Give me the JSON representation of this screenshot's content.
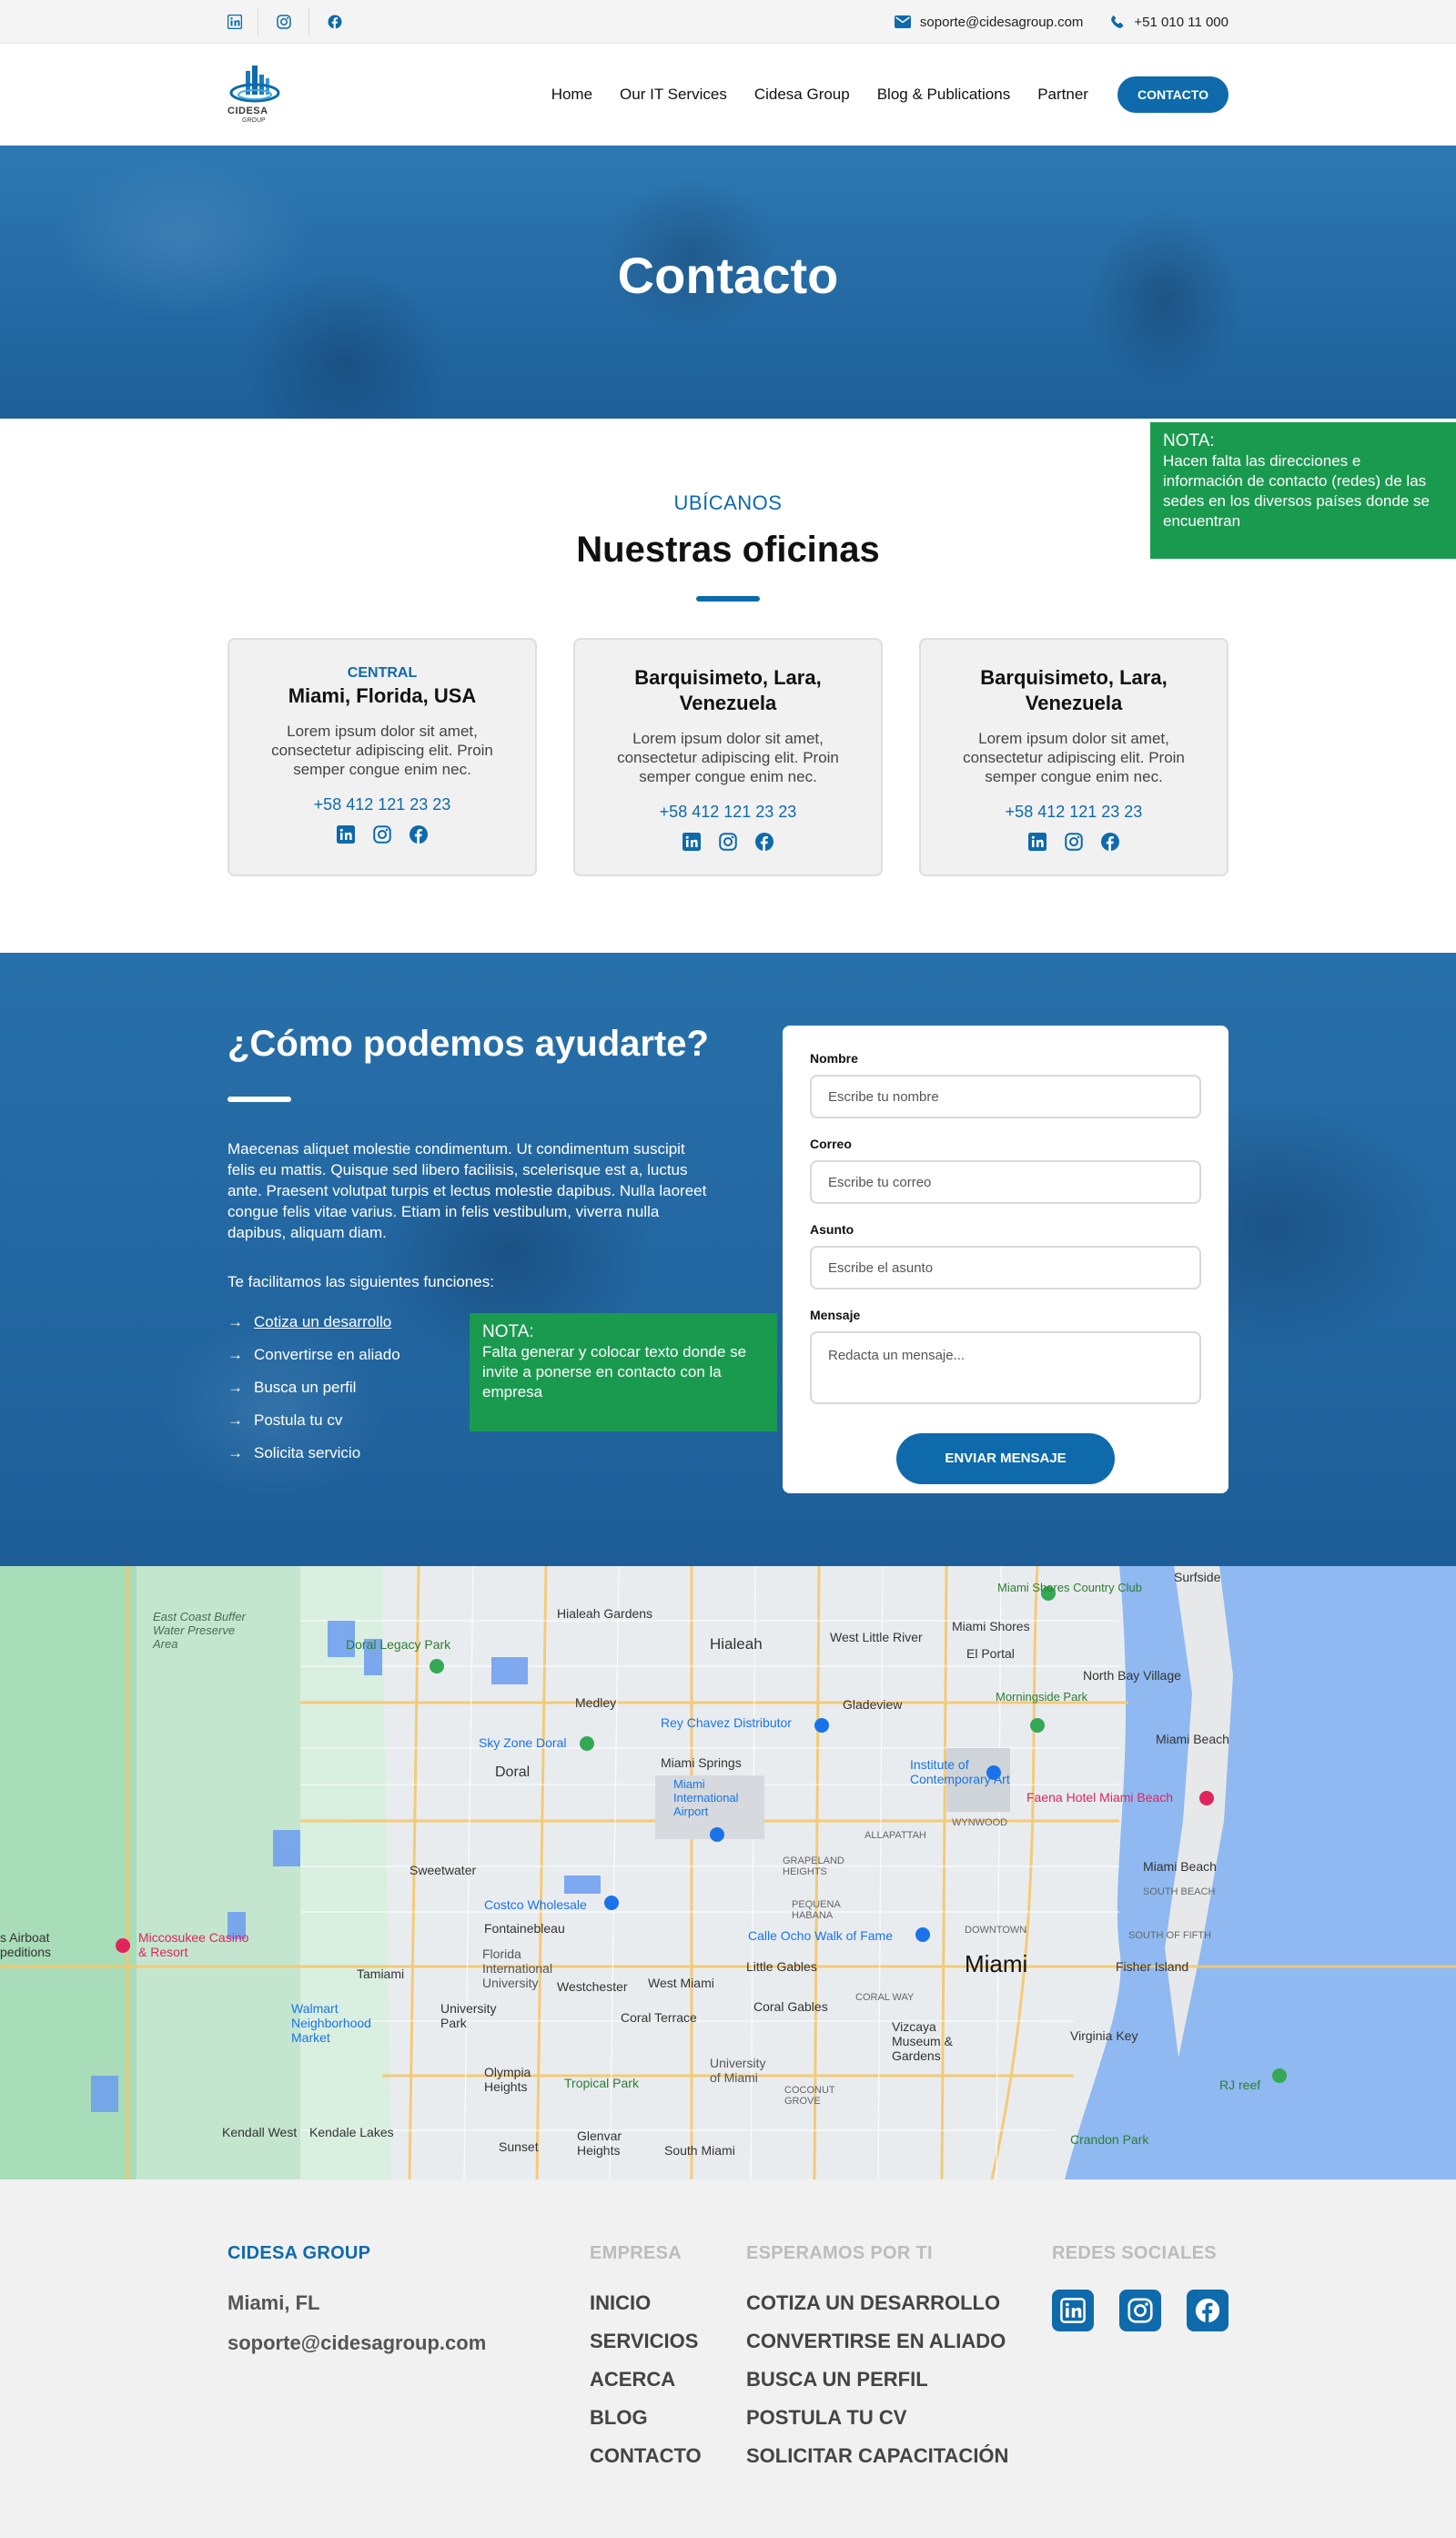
{
  "topbar": {
    "social": [
      "linkedin-icon",
      "instagram-icon",
      "facebook-icon"
    ],
    "email": "soporte@cidesagroup.com",
    "phone": "+51 010 11 000"
  },
  "header": {
    "logo_text": "CIDESA",
    "logo_sub": "GROUP",
    "nav": [
      "Home",
      "Our IT Services",
      "Cidesa Group",
      "Blog & Publications",
      "Partner"
    ],
    "cta": "CONTACTO"
  },
  "hero": {
    "title": "Contacto"
  },
  "notes": {
    "offices_label": "NOTA:",
    "offices_text": "Hacen falta las direcciones e información de contacto (redes) de las sedes en los diversos países donde se encuentran",
    "help_label": "NOTA:",
    "help_text": "Falta generar y colocar texto donde se invite a ponerse en contacto con la empresa"
  },
  "offices": {
    "eyebrow": "UBÍCANOS",
    "title": "Nuestras oficinas",
    "cards": [
      {
        "tag": "CENTRAL",
        "city": "Miami, Florida, USA",
        "text": "Lorem ipsum dolor sit amet, consectetur adipiscing elit. Proin semper congue enim nec.",
        "phone": "+58 412 121 23 23"
      },
      {
        "tag": "",
        "city": "Barquisimeto, Lara, Venezuela",
        "text": "Lorem ipsum dolor sit amet, consectetur adipiscing elit. Proin semper congue enim nec.",
        "phone": "+58 412 121 23 23"
      },
      {
        "tag": "",
        "city": "Barquisimeto, Lara, Venezuela",
        "text": "Lorem ipsum dolor sit amet, consectetur adipiscing elit. Proin semper congue enim nec.",
        "phone": "+58 412 121 23 23"
      }
    ]
  },
  "help": {
    "title": "¿Cómo podemos ayudarte?",
    "description": "Maecenas aliquet molestie condimentum. Ut condimentum suscipit felis eu mattis. Quisque sed libero facilisis, scelerisque est a, luctus ante. Praesent volutpat turpis et lectus molestie dapibus. Nulla laoreet congue felis vitae varius. Etiam in felis vestibulum, viverra nulla dapibus, aliquam diam.",
    "lead": "Te facilitamos las siguientes funciones:",
    "functions": [
      "Cotiza un desarrollo",
      "Convertirse en aliado",
      "Busca un perfil",
      "Postula tu cv",
      "Solicita servicio"
    ]
  },
  "form": {
    "fields": [
      {
        "label": "Nombre",
        "placeholder": "Escribe tu nombre"
      },
      {
        "label": "Correo",
        "placeholder": "Escribe tu correo"
      },
      {
        "label": "Asunto",
        "placeholder": "Escribe el asunto"
      },
      {
        "label": "Mensaje",
        "placeholder": "Redacta un mensaje..."
      }
    ],
    "submit": "ENVIAR MENSAJE"
  },
  "map": {
    "labels": {
      "miami": "Miami",
      "hialeah": "Hialeah",
      "hialeah_gardens": "Hialeah Gardens",
      "west_little_river": "West Little River",
      "el_portal": "El Portal",
      "miami_shores": "Miami Shores",
      "north_bay_village": "North Bay Village",
      "gladeview": "Gladeview",
      "medley": "Medley",
      "doral": "Doral",
      "miami_springs": "Miami Springs",
      "miami_beach": "Miami Beach",
      "sweetwater": "Sweetwater",
      "fontainebleau": "Fontainebleau",
      "little_gables": "Little Gables",
      "west_miami": "West Miami",
      "coral_terrace": "Coral Terrace",
      "coral_gables": "Coral Gables",
      "tamiami": "Tamiami",
      "university_park": "University Park",
      "westchester": "Westchester",
      "olympia_heights": "Olympia Heights",
      "tropical_park": "Tropical Park",
      "kendall_west": "Kendall West",
      "kendale_lakes": "Kendale Lakes",
      "sunset": "Sunset",
      "glenvar_heights": "Glenvar Heights",
      "south_miami": "South Miami",
      "fisher_island": "Fisher Island",
      "virginia_key": "Virginia Key",
      "crandon_park": "Crandon Park",
      "rj_reef": "RJ reef",
      "surfside": "Surfside",
      "east_coast": "East Coast Buffer Water Preserve Area",
      "doral_legacy": "Doral Legacy Park",
      "sky_zone": "Sky Zone Doral",
      "rey_chavez": "Rey Chavez Distributor",
      "airport": "Miami International Airport",
      "ica": "Institute of Contemporary Art",
      "faena": "Faena Hotel Miami Beach",
      "costco": "Costco Wholesale",
      "calle_ocho": "Calle Ocho Walk of Fame",
      "miccosukee": "Miccosukee Casino & Resort",
      "walmart": "Walmart Neighborhood Market",
      "fiu": "Florida International University",
      "vizcaya": "Vizcaya Museum & Gardens",
      "um": "University of Miami",
      "morningside": "Morningside Park",
      "miami_shores_cc": "Miami Shores Country Club",
      "airboat": "s Airboat peditions",
      "allapattah": "ALLAPATTAH",
      "wynwood": "WYNWOOD",
      "downtown": "DOWNTOWN",
      "pequena": "PEQUENA HABANA",
      "grapeland": "GRAPELAND HEIGHTS",
      "coral_way": "CORAL WAY",
      "south_beach": "SOUTH BEACH",
      "south_of_fifth": "SOUTH OF FIFTH",
      "coconut_grove": "COCONUT GROVE"
    }
  },
  "footer": {
    "brand": "CIDESA GROUP",
    "city": "Miami, FL",
    "email": "soporte@cidesagroup.com",
    "empresa_title": "EMPRESA",
    "empresa_links": [
      "INICIO",
      "SERVICIOS",
      "ACERCA",
      "BLOG",
      "CONTACTO"
    ],
    "esperamos_title": "ESPERAMOS POR TI",
    "esperamos_links": [
      "COTIZA UN DESARROLLO",
      "CONVERTIRSE EN ALIADO",
      "BUSCA UN PERFIL",
      "POSTULA TU CV",
      "SOLICITAR CAPACITACIÓN"
    ],
    "social_title": "REDES SOCIALES"
  },
  "colors": {
    "primary": "#0e6aab",
    "note": "#1a9a4f",
    "footer_bg": "#f1f1f1"
  }
}
